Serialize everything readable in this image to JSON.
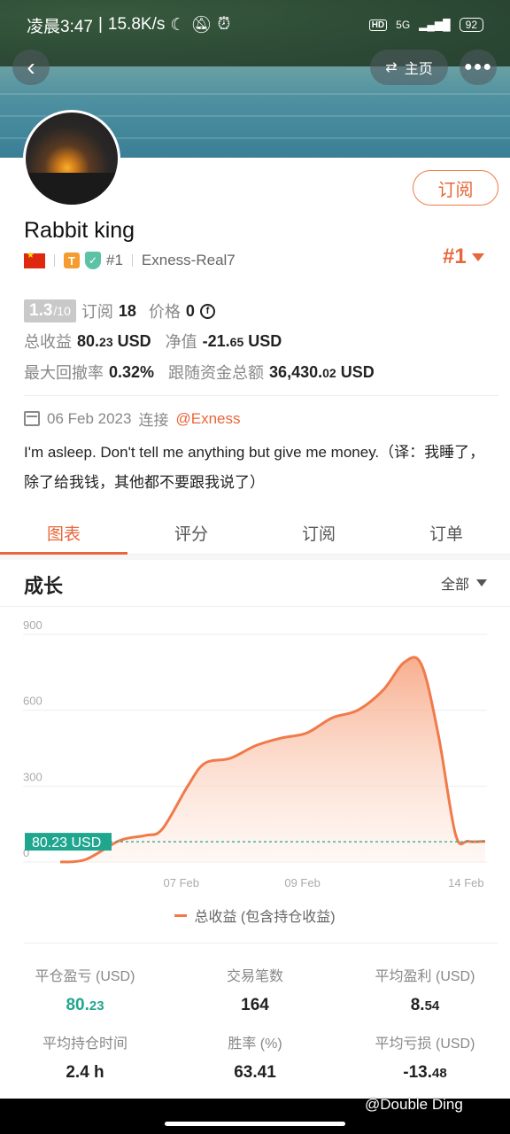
{
  "status_bar": {
    "time": "凌晨3:47",
    "speed": "15.8K/s",
    "icons": [
      "moon-icon",
      "mute-bell-icon",
      "alarm-icon"
    ],
    "network": "5G",
    "battery": "92"
  },
  "nav": {
    "home_label": "主页"
  },
  "profile": {
    "subscribe_label": "订阅",
    "name": "Rabbit king",
    "rank_small": "#1",
    "server": "Exness-Real7",
    "rank_big": "#1",
    "score": "1.3",
    "score_max": "/10",
    "subscribers_label": "订阅",
    "subscribers": "18",
    "price_label": "价格",
    "price": "0",
    "total_profit_label": "总收益",
    "total_profit_int": "80.",
    "total_profit_dec": "23",
    "total_profit_unit": "USD",
    "equity_label": "净值",
    "equity_int": "-21.",
    "equity_dec": "65",
    "equity_unit": "USD",
    "drawdown_label": "最大回撤率",
    "drawdown": "0.32%",
    "follow_funds_label": "跟随资金总额",
    "follow_funds_int": "36,430.",
    "follow_funds_dec": "02",
    "follow_funds_unit": "USD",
    "joined_date": "06 Feb 2023",
    "joined_label": "连接",
    "broker": "@Exness",
    "bio": "I'm asleep. Don't tell me anything but give me money.（译：我睡了，除了给我钱，其他都不要跟我说了）"
  },
  "tabs": [
    {
      "label": "图表",
      "active": true
    },
    {
      "label": "评分",
      "active": false
    },
    {
      "label": "订阅",
      "active": false
    },
    {
      "label": "订单",
      "active": false
    }
  ],
  "chart_section": {
    "title": "成长",
    "filter": "全部"
  },
  "chart_data": {
    "type": "area",
    "y_ticks": [
      "900",
      "600",
      "300",
      "0"
    ],
    "x_ticks": [
      "07 Feb",
      "09 Feb",
      "14 Feb"
    ],
    "ylim": [
      0,
      900
    ],
    "current_label": "80.23 USD",
    "current_value": 80.23,
    "legend": "总收益 (包含持仓收益)",
    "series": [
      {
        "name": "总收益 (包含持仓收益)",
        "points": [
          [
            0.0,
            0
          ],
          [
            0.06,
            10
          ],
          [
            0.14,
            85
          ],
          [
            0.2,
            105
          ],
          [
            0.24,
            130
          ],
          [
            0.3,
            300
          ],
          [
            0.34,
            390
          ],
          [
            0.4,
            410
          ],
          [
            0.46,
            460
          ],
          [
            0.52,
            490
          ],
          [
            0.58,
            510
          ],
          [
            0.64,
            570
          ],
          [
            0.7,
            600
          ],
          [
            0.76,
            680
          ],
          [
            0.81,
            790
          ],
          [
            0.85,
            780
          ],
          [
            0.89,
            500
          ],
          [
            0.93,
            110
          ],
          [
            0.96,
            82
          ],
          [
            1.0,
            82
          ]
        ]
      }
    ],
    "color": "#f07a4a"
  },
  "stats": [
    {
      "label": "平仓盈亏 (USD)",
      "int": "80.",
      "dec": "23",
      "color": "green"
    },
    {
      "label": "交易笔数",
      "int": "164",
      "dec": ""
    },
    {
      "label": "平均盈利 (USD)",
      "int": "8.",
      "dec": "54"
    },
    {
      "label": "平均持仓时间",
      "int": "2.4 h",
      "dec": ""
    },
    {
      "label": "胜率 (%)",
      "int": "63.41",
      "dec": ""
    },
    {
      "label": "平均亏损 (USD)",
      "int": "-13.",
      "dec": "48"
    }
  ],
  "watermark": "@Double Ding"
}
